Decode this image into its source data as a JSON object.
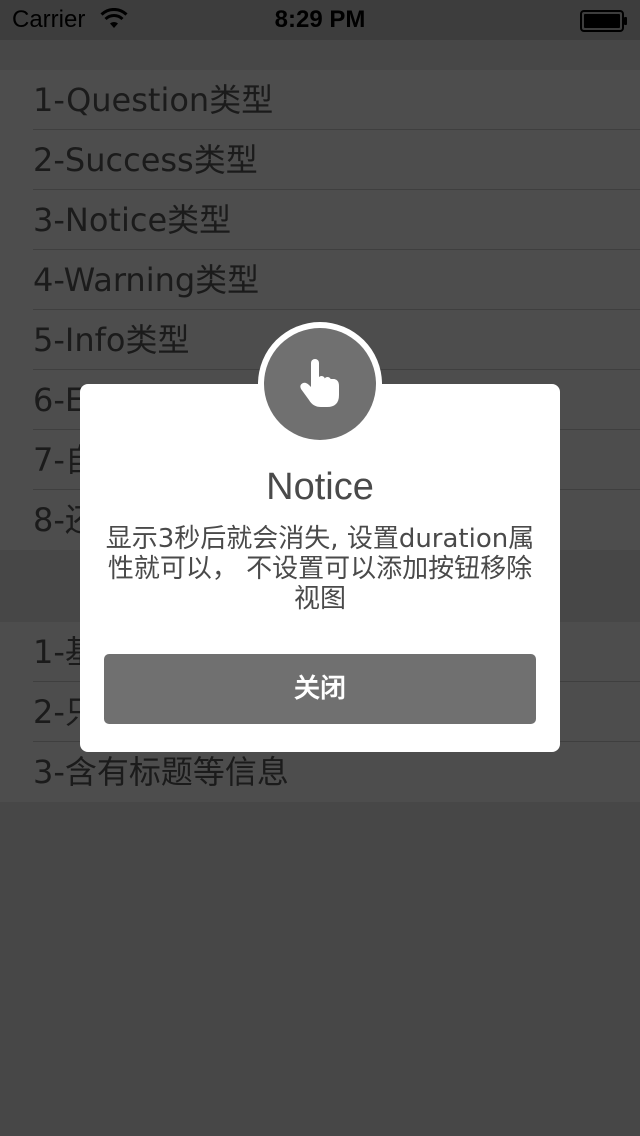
{
  "status_bar": {
    "carrier": "Carrier",
    "time": "8:29 PM"
  },
  "list_section_1": {
    "items": [
      "1-Question类型",
      "2-Success类型",
      "3-Notice类型",
      "4-Warning类型",
      "5-Info类型",
      "6-E",
      "7-自",
      "8-还"
    ]
  },
  "list_section_2": {
    "items": [
      "1-基",
      "2-只",
      "3-含有标题等信息"
    ]
  },
  "alert": {
    "icon": "hand-pointer-icon",
    "title": "Notice",
    "message": "显示3秒后就会消失, 设置duration属性就可以， 不设置可以添加按钮移除视图",
    "button_label": "关闭",
    "colors": {
      "icon_circle": "#707070",
      "button": "#707070",
      "overlay": "#474747"
    }
  }
}
